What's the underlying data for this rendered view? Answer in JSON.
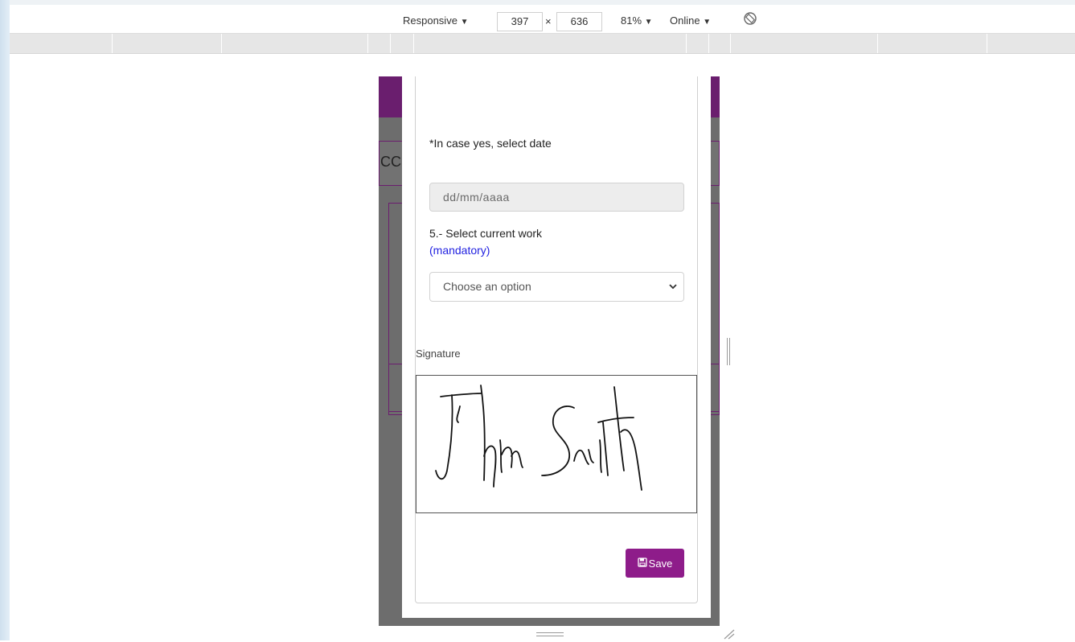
{
  "devtools": {
    "device_mode": "Responsive",
    "width": "397",
    "times": "×",
    "height": "636",
    "zoom": "81%",
    "network": "Online",
    "dropdown_glyph": "▼",
    "rotate_icon": "rotate-icon"
  },
  "viewport_background": {
    "partial_heading": "CC"
  },
  "form": {
    "date_question": "*In case yes, select date",
    "date_placeholder": "dd/mm/aaaa",
    "work_question": "5.- Select current work",
    "mandatory": "(mandatory)",
    "work_select_value": "Choose an option",
    "signature_label": "Signature",
    "signature_text": "John Smith",
    "save_label": "Save"
  },
  "colors": {
    "accent": "#8e1c8a",
    "header_purple": "#6a1e6e",
    "mandatory_blue": "#1f1fe0"
  }
}
